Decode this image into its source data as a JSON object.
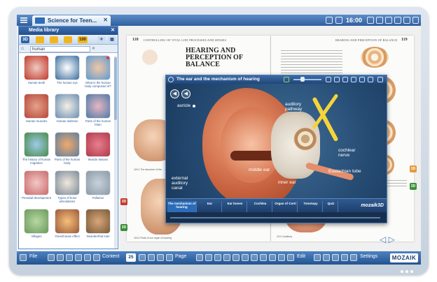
{
  "topbar": {
    "tab_title": "Science for Teen...",
    "clock": "16:00"
  },
  "sidebar": {
    "title": "Media library",
    "tools": [
      "3D",
      "100"
    ],
    "search_value": "human",
    "items": [
      {
        "label": "Human teeth",
        "color": "#c0392b"
      },
      {
        "label": "The human eye",
        "color": "#3a6e9e"
      },
      {
        "label": "What is the human body composed of?",
        "color": "#5d9bd1"
      },
      {
        "label": "Human muscles",
        "color": "#b5473a"
      },
      {
        "label": "Human skeleton",
        "color": "#6a8fb5"
      },
      {
        "label": "Parts of the human brain",
        "color": "#4c7aa8"
      },
      {
        "label": "The history of human migration",
        "color": "#4a8a4a"
      },
      {
        "label": "Parts of the human body",
        "color": "#5e7fa0"
      },
      {
        "label": "Muscle tissues",
        "color": "#b03a4a"
      },
      {
        "label": "Prenatal development",
        "color": "#c96a6a"
      },
      {
        "label": "Types of bone articulations",
        "color": "#7a8a9a"
      },
      {
        "label": "Pollution",
        "color": "#8a9aa8"
      },
      {
        "label": "Villages",
        "color": "#6a9a5a"
      },
      {
        "label": "Greenhouse effect",
        "color": "#9a5a3a"
      },
      {
        "label": "Neanderthal man",
        "color": "#7a5a3a"
      }
    ]
  },
  "book": {
    "left_page_number": "118",
    "left_chapter": "CONTROLLING OF VITAL LIFE PROCESSES AND SENSES",
    "heading": "HEARING AND PERCEPTION OF BALANCE",
    "right_page_number": "119",
    "right_chapter": "HEARING AND PERCEPTION OF BALANCE",
    "caption_1": "118.1 The structure of the ...",
    "caption_2": "118.2 Parts of our organ of hearing",
    "caption_3": "119.1 Auditory",
    "badge_3d": "3D"
  },
  "player": {
    "title": "The ear and the mechanism of hearing",
    "labels": {
      "auricle": "auricle",
      "auditory_pathway": "auditory pathway",
      "cochlear_nerve": "cochlear nerve",
      "eustachian_tube": "Eustachian tube",
      "middle_ear": "middle ear",
      "inner_ear": "inner ear",
      "external_canal": "external auditory canal"
    },
    "tabs": [
      "The mechanism of hearing",
      "Ear",
      "Ear bones",
      "Cochlea",
      "Organ of Corti",
      "Tonotopy",
      "Quiz"
    ],
    "brand": "mozaik3D"
  },
  "bottombar": {
    "file": "File",
    "content": "Content",
    "page_number": "25",
    "page": "Page",
    "edit": "Edit",
    "settings": "Settings",
    "logo": "MOZAIK"
  }
}
